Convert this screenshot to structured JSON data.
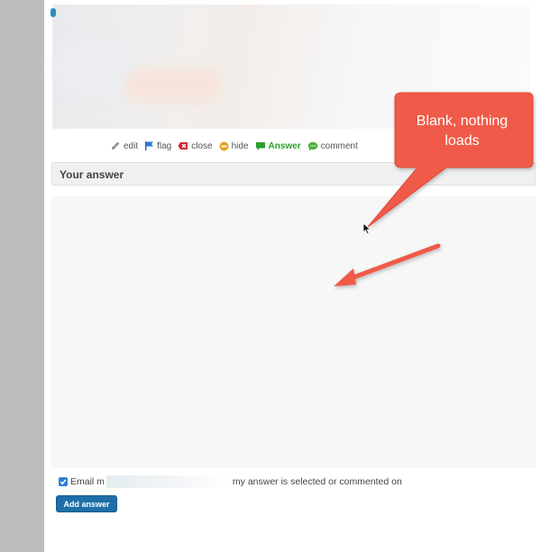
{
  "actions": [
    {
      "label": "edit",
      "icon": "pencil-icon"
    },
    {
      "label": "flag",
      "icon": "flag-icon"
    },
    {
      "label": "close",
      "icon": "close-icon"
    },
    {
      "label": "hide",
      "icon": "hide-icon"
    },
    {
      "label": "Answer",
      "icon": "answer-icon"
    },
    {
      "label": "comment",
      "icon": "comment-icon"
    }
  ],
  "answer_section": {
    "title": "Your answer"
  },
  "email_option": {
    "checked": true,
    "prefix": "Email m",
    "suffix": "my answer is selected or commented on"
  },
  "add_answer_button": "Add answer",
  "annotation": {
    "line1": "Blank, nothing",
    "line2": "loads",
    "color": "#f05a4a"
  },
  "colors": {
    "answer_green": "#2e9c2a",
    "button_blue": "#1e6fa8",
    "gutter": "#bdbdbd"
  }
}
